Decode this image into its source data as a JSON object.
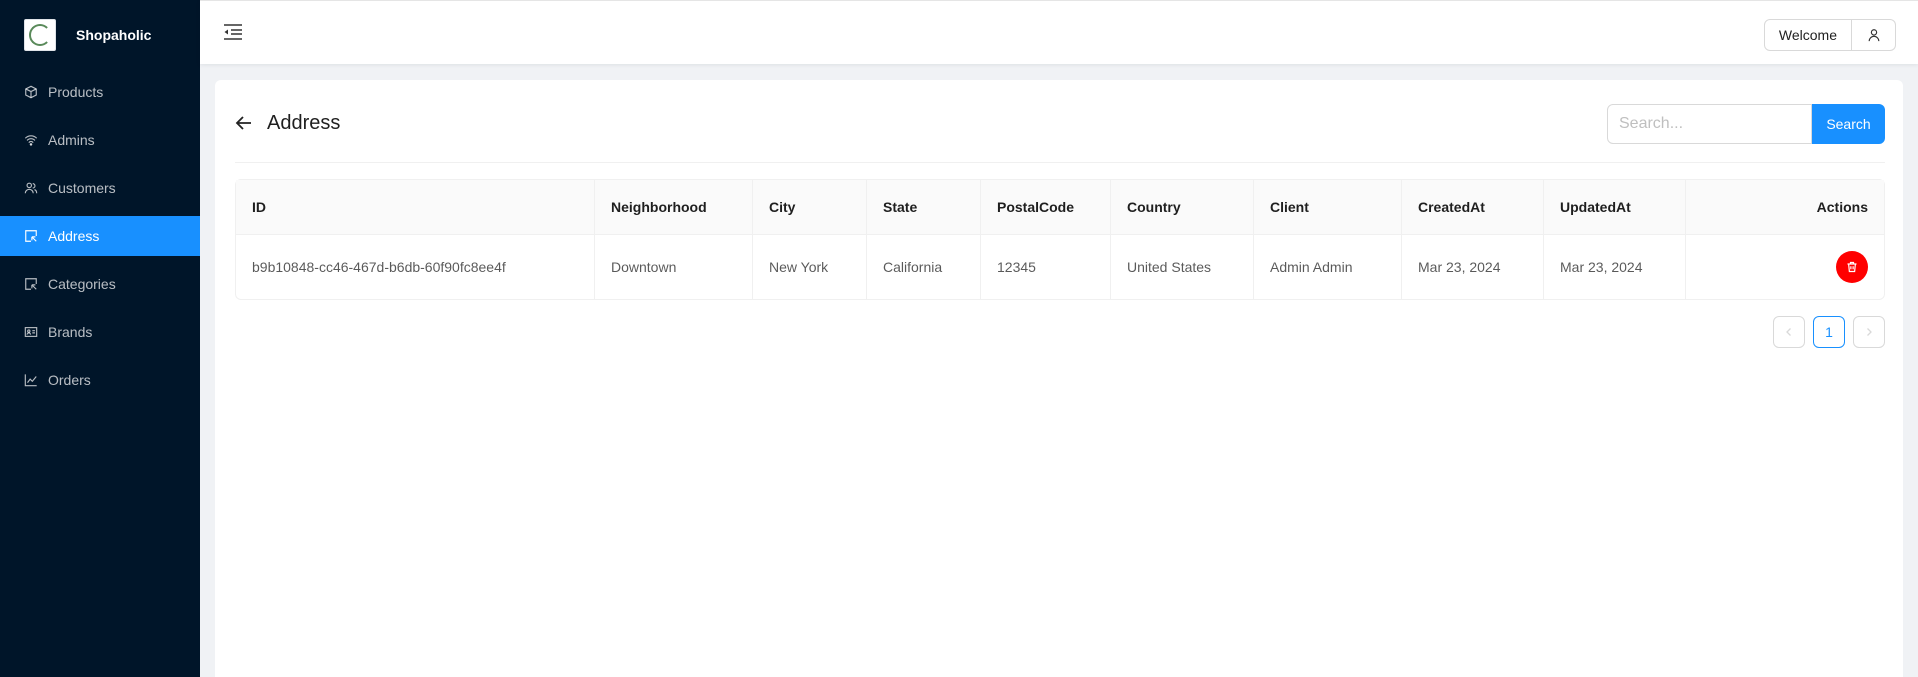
{
  "app": {
    "brand": "Shopaholic"
  },
  "sidebar": {
    "items": [
      {
        "label": "Products",
        "icon": "box-icon",
        "active": false
      },
      {
        "label": "Admins",
        "icon": "wifi-icon",
        "active": false
      },
      {
        "label": "Customers",
        "icon": "users-icon",
        "active": false
      },
      {
        "label": "Address",
        "icon": "select-icon",
        "active": true
      },
      {
        "label": "Categories",
        "icon": "select-icon",
        "active": false
      },
      {
        "label": "Brands",
        "icon": "id-card-icon",
        "active": false
      },
      {
        "label": "Orders",
        "icon": "chart-icon",
        "active": false
      }
    ]
  },
  "header": {
    "welcome_label": "Welcome"
  },
  "page": {
    "title": "Address",
    "search": {
      "placeholder": "Search...",
      "button_label": "Search"
    }
  },
  "table": {
    "columns": [
      "ID",
      "Neighborhood",
      "City",
      "State",
      "PostalCode",
      "Country",
      "Client",
      "CreatedAt",
      "UpdatedAt",
      "Actions"
    ],
    "rows": [
      [
        "b9b10848-cc46-467d-b6db-60f90fc8ee4f",
        "Downtown",
        "New York",
        "California",
        "12345",
        "United States",
        "Admin Admin",
        "Mar 23, 2024",
        "Mar 23, 2024"
      ]
    ]
  },
  "pagination": {
    "current_page": "1"
  },
  "colors": {
    "sider_bg": "#001529",
    "primary": "#1890ff",
    "danger": "#ff0000"
  }
}
